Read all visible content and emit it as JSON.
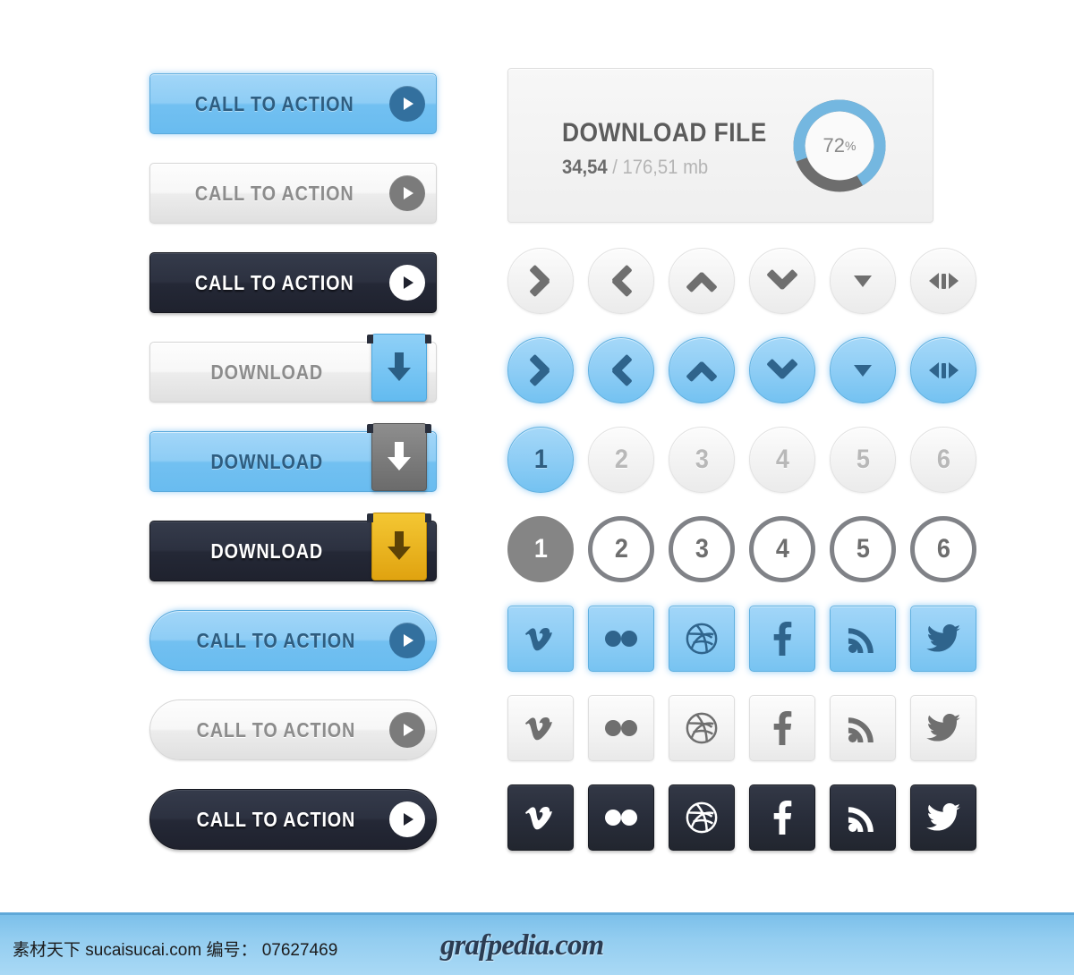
{
  "left_column": {
    "buttons": [
      {
        "label": "CALL TO ACTION",
        "style": "blue-rect",
        "icon": "play-icon"
      },
      {
        "label": "CALL TO ACTION",
        "style": "light-rect",
        "icon": "play-icon"
      },
      {
        "label": "CALL TO ACTION",
        "style": "dark-rect",
        "icon": "play-icon"
      },
      {
        "label": "DOWNLOAD",
        "style": "light-rect",
        "icon": "download-arrow-icon"
      },
      {
        "label": "DOWNLOAD",
        "style": "blue-rect",
        "icon": "download-arrow-icon"
      },
      {
        "label": "DOWNLOAD",
        "style": "dark-rect",
        "icon": "download-arrow-icon"
      },
      {
        "label": "CALL TO ACTION",
        "style": "blue-pill",
        "icon": "play-icon"
      },
      {
        "label": "CALL TO ACTION",
        "style": "light-pill",
        "icon": "play-icon"
      },
      {
        "label": "CALL TO ACTION",
        "style": "dark-pill",
        "icon": "play-icon"
      }
    ]
  },
  "download_panel": {
    "title": "DOWNLOAD FILE",
    "downloaded": "34,54",
    "separator": " / ",
    "total": "176,51 mb",
    "percent_value": 72,
    "percent_label": "72",
    "percent_symbol": "%",
    "progress_color": "#74b7e0",
    "track_color": "#6d6d6d"
  },
  "arrow_rows": [
    {
      "variant": "light",
      "buttons": [
        {
          "icon": "chevron-left-icon",
          "name": "arrow-left"
        },
        {
          "icon": "chevron-right-icon",
          "name": "arrow-right"
        },
        {
          "icon": "chevron-up-icon",
          "name": "arrow-up"
        },
        {
          "icon": "chevron-down-icon",
          "name": "arrow-down"
        },
        {
          "icon": "triangle-down-icon",
          "name": "dropdown"
        },
        {
          "icon": "expand-horizontal-icon",
          "name": "expand"
        }
      ]
    },
    {
      "variant": "blue",
      "buttons": [
        {
          "icon": "chevron-left-icon",
          "name": "arrow-left"
        },
        {
          "icon": "chevron-right-icon",
          "name": "arrow-right"
        },
        {
          "icon": "chevron-up-icon",
          "name": "arrow-up"
        },
        {
          "icon": "chevron-down-icon",
          "name": "arrow-down"
        },
        {
          "icon": "triangle-down-icon",
          "name": "dropdown"
        },
        {
          "icon": "expand-horizontal-icon",
          "name": "expand"
        }
      ]
    }
  ],
  "pagination": [
    {
      "variant": "filled",
      "active_index": 0,
      "pages": [
        "1",
        "2",
        "3",
        "4",
        "5",
        "6"
      ]
    },
    {
      "variant": "outline",
      "active_index": 0,
      "pages": [
        "1",
        "2",
        "3",
        "4",
        "5",
        "6"
      ]
    }
  ],
  "social_rows": [
    {
      "variant": "blue",
      "icons": [
        "vimeo-icon",
        "flickr-icon",
        "dribbble-icon",
        "facebook-icon",
        "rss-icon",
        "twitter-icon"
      ]
    },
    {
      "variant": "light",
      "icons": [
        "vimeo-icon",
        "flickr-icon",
        "dribbble-icon",
        "facebook-icon",
        "rss-icon",
        "twitter-icon"
      ]
    },
    {
      "variant": "dark",
      "icons": [
        "vimeo-icon",
        "flickr-icon",
        "dribbble-icon",
        "facebook-icon",
        "rss-icon",
        "twitter-icon"
      ]
    }
  ],
  "social_names": {
    "vimeo-icon": "Vimeo",
    "flickr-icon": "Flickr",
    "dribbble-icon": "Dribbble",
    "facebook-icon": "Facebook",
    "rss-icon": "RSS",
    "twitter-icon": "Twitter"
  },
  "footer": {
    "watermark": "素材天下 sucaisucai.com  编号： 07627469",
    "brand": "grafpedia.com"
  },
  "colors": {
    "accent_blue": "#8ecdf5",
    "dark": "#282d3a",
    "gold": "#e8ae14",
    "text_gray": "#8c8c8c"
  }
}
